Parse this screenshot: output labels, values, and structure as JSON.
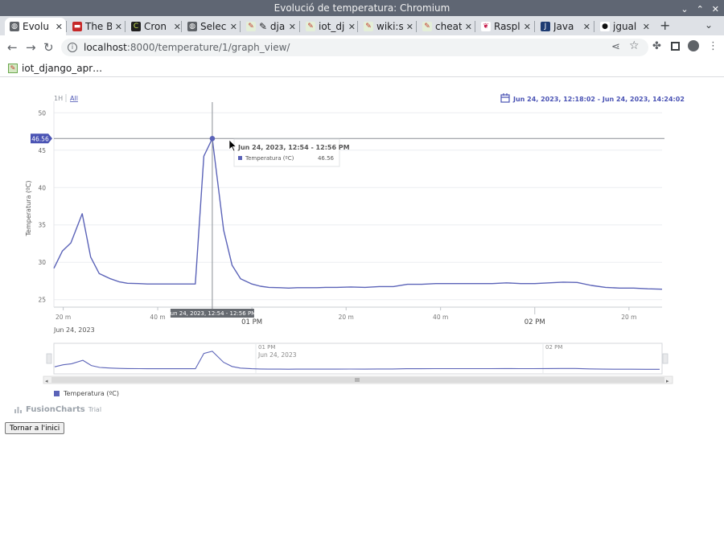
{
  "window": {
    "title": "Evolució de temperatura: Chromium"
  },
  "tabs": [
    {
      "label": "Evolu",
      "icon": "globe-icon",
      "active": true
    },
    {
      "label": "The B",
      "icon": "red-badge-icon",
      "active": false
    },
    {
      "label": "Cron",
      "icon": "cron-icon",
      "active": false
    },
    {
      "label": "Selec",
      "icon": "globe-icon",
      "active": false
    },
    {
      "label": "✎ dja",
      "icon": "django-icon",
      "active": false
    },
    {
      "label": "iot_dj",
      "icon": "django-icon",
      "active": false
    },
    {
      "label": "wiki:s",
      "icon": "django-icon",
      "active": false
    },
    {
      "label": "cheat",
      "icon": "django-icon",
      "active": false
    },
    {
      "label": "Raspl",
      "icon": "raspberry-icon",
      "active": false
    },
    {
      "label": "Java",
      "icon": "javascript-icon",
      "active": false
    },
    {
      "label": "jgual",
      "icon": "github-icon",
      "active": false
    }
  ],
  "address_bar": {
    "host": "localhost",
    "path": ":8000/temperature/1/graph_view/"
  },
  "bookmarks": [
    {
      "label": "iot_django_apr…",
      "icon": "django-icon"
    }
  ],
  "chart_data": {
    "type": "line",
    "range_buttons": [
      "1H",
      "All"
    ],
    "selected_range": "All",
    "date_range_label": "Jun 24, 2023, 12:18:02 - Jun 24, 2023, 14:24:02",
    "ylabel": "Temperatura (ºC)",
    "ylim": [
      24,
      51
    ],
    "yticks": [
      25,
      30,
      35,
      40,
      45,
      50
    ],
    "x_range_minutes": [
      12.3,
      14.45
    ],
    "x_ticks": [
      {
        "label": "20 m",
        "t": 12.333
      },
      {
        "label": "40 m",
        "t": 12.667
      },
      {
        "label": "01 PM",
        "t": 13.0,
        "major": true
      },
      {
        "label": "20 m",
        "t": 13.333
      },
      {
        "label": "40 m",
        "t": 13.667
      },
      {
        "label": "02 PM",
        "t": 14.0,
        "major": true
      },
      {
        "label": "20 m",
        "t": 14.333
      }
    ],
    "x_date_label": "Jun 24, 2023",
    "series": [
      {
        "name": "Temperatura (ºC)",
        "color": "#5b63b8",
        "x": [
          12.3,
          12.33,
          12.36,
          12.4,
          12.43,
          12.46,
          12.5,
          12.53,
          12.56,
          12.6,
          12.63,
          12.66,
          12.7,
          12.73,
          12.76,
          12.8,
          12.83,
          12.86,
          12.9,
          12.93,
          12.96,
          13.0,
          13.03,
          13.06,
          13.1,
          13.13,
          13.16,
          13.2,
          13.23,
          13.26,
          13.3,
          13.35,
          13.4,
          13.45,
          13.5,
          13.55,
          13.6,
          13.65,
          13.7,
          13.75,
          13.8,
          13.85,
          13.9,
          13.95,
          14.0,
          14.05,
          14.1,
          14.15,
          14.2,
          14.25,
          14.3,
          14.35,
          14.4,
          14.45
        ],
        "values": [
          29.2,
          31.5,
          32.6,
          36.5,
          30.7,
          28.5,
          27.8,
          27.4,
          27.2,
          27.15,
          27.1,
          27.1,
          27.1,
          27.1,
          27.1,
          27.1,
          44.2,
          46.56,
          34.3,
          29.6,
          27.8,
          27.1,
          26.8,
          26.65,
          26.6,
          26.55,
          26.6,
          26.6,
          26.6,
          26.65,
          26.65,
          26.7,
          26.65,
          26.75,
          26.75,
          27.05,
          27.05,
          27.15,
          27.15,
          27.15,
          27.15,
          27.15,
          27.25,
          27.15,
          27.15,
          27.25,
          27.35,
          27.3,
          26.9,
          26.65,
          26.55,
          26.55,
          26.45,
          26.4
        ]
      }
    ],
    "crosshair": {
      "y_label": "46.56",
      "x_label": "Jun 24, 2023, 12:54 - 12:56 PM"
    },
    "tooltip": {
      "title": "Jun 24, 2023, 12:54 - 12:56 PM",
      "series_name": "Temperatura (ºC)",
      "value": "46.56"
    },
    "navigator": {
      "labels": [
        "01 PM",
        "Jun 24, 2023",
        "02 PM"
      ]
    },
    "legend": {
      "position": "bottom-left",
      "entries": [
        "Temperatura (ºC)"
      ]
    }
  },
  "credits": {
    "brand": "FusionCharts",
    "suffix": "Trial"
  },
  "back_button": {
    "label": "Tornar a l'inici"
  }
}
